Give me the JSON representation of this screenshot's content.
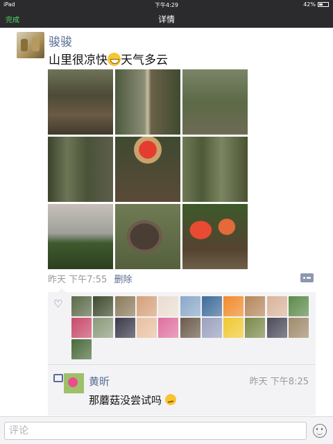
{
  "status_bar": {
    "device": "iPad",
    "time": "下午4:29",
    "battery": "42%"
  },
  "nav": {
    "done_label": "完成",
    "title": "详情"
  },
  "post": {
    "author": "骏骏",
    "text": "山里很凉快",
    "text_emoji": "grinning-face-emoji",
    "text_suffix": "天气多云",
    "photos": [
      "forest-path-with-roots",
      "forest-stone-stairs",
      "forest-trail-with-bench",
      "forest-signpost",
      "red-mushroom",
      "cedar-forest",
      "mountain-view",
      "raccoon-dog",
      "red-mushrooms-pair"
    ],
    "time": "昨天 下午7:55",
    "delete_label": "删除"
  },
  "likes": {
    "avatar_colors": [
      "#5a6a48",
      "#3e4a2c",
      "#8a7a5a",
      "#d6a07a",
      "#e9ddd0",
      "#8aa8c8",
      "#3f6b9a",
      "#f08a2a",
      "#b5865a",
      "#d9b49a",
      "#5c8a4a",
      "#c84a6a",
      "#8a9a7a",
      "#3a3a4a",
      "#e8c0a0",
      "#e070a0",
      "#6a5a4a",
      "#9aa0c0",
      "#f0c830",
      "#7a8a4a",
      "#4a4a5a",
      "#a08a6a",
      "#4a6a3a"
    ]
  },
  "comment": {
    "author": "黄昕",
    "time": "昨天 下午8:25",
    "text": "那蘑菇没尝试吗",
    "emoji": "thinking-face-emoji"
  },
  "input": {
    "placeholder": "评论"
  }
}
